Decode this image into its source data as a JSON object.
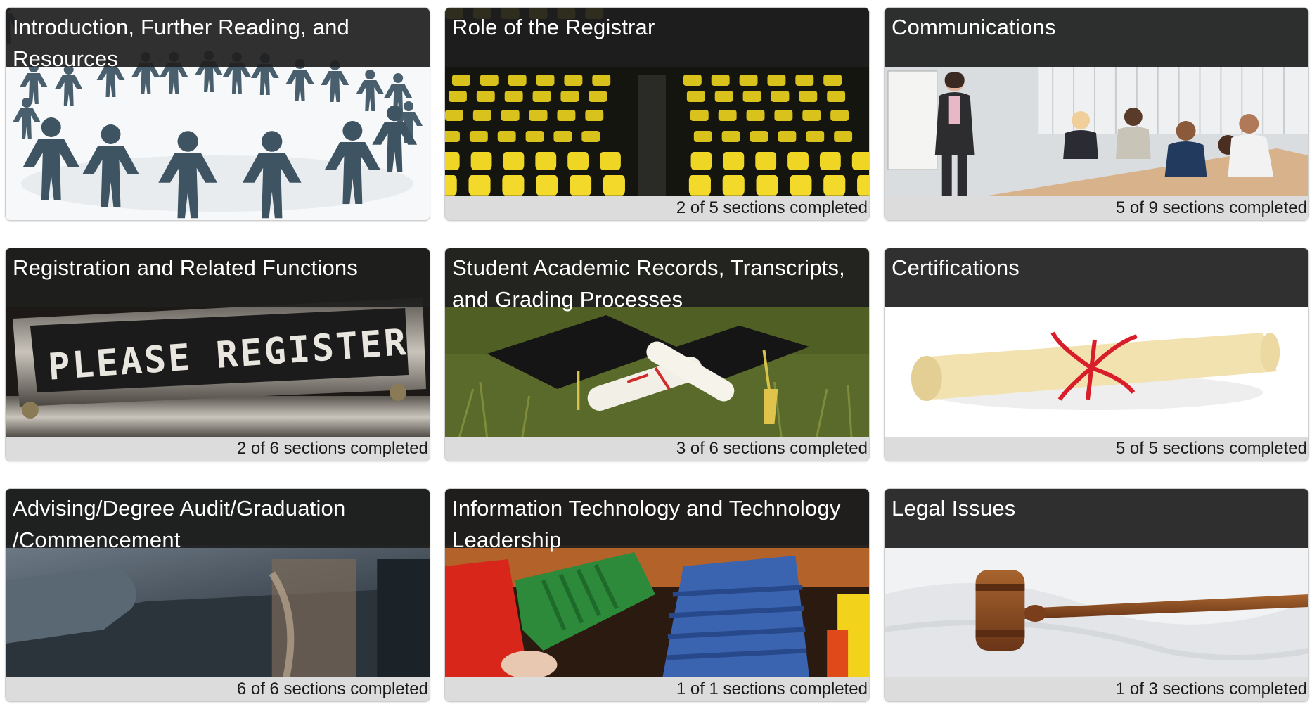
{
  "tiles": [
    {
      "title": "Introduction, Further Reading, and Resources",
      "progress": "",
      "image": "paper-people-circle-image"
    },
    {
      "title": "Role of the Registrar",
      "progress": "2 of 5 sections completed",
      "image": "auditorium-seats-image"
    },
    {
      "title": "Communications",
      "progress": "5 of 9 sections completed",
      "image": "meeting-room-image"
    },
    {
      "title": "Registration and Related Functions",
      "progress": "2 of 6 sections completed",
      "image": "please-register-sign-image",
      "sign_text": "PLEASE REGISTER"
    },
    {
      "title": "Student Academic Records, Transcripts, and Grading Processes",
      "progress": "3 of 6 sections completed",
      "image": "graduation-caps-diploma-image"
    },
    {
      "title": "Certifications",
      "progress": "5 of 5 sections completed",
      "image": "diploma-scroll-image"
    },
    {
      "title": "Advising/Degree Audit/Graduation /Commencement",
      "progress": "6 of 6 sections completed",
      "image": "graduation-cap-closeup-image"
    },
    {
      "title": "Information Technology and Technology Leadership",
      "progress": "1 of 1 sections completed",
      "image": "network-cables-image"
    },
    {
      "title": "Legal Issues",
      "progress": "1 of 3 sections completed",
      "image": "gavel-image"
    }
  ],
  "colors": {
    "title_bar": "#1e1e1e",
    "progress_bar": "#dcdcdc",
    "seat_yellow": "#e8d21e",
    "cable_red": "#d8261a",
    "cable_green": "#2c8a3a",
    "cable_blue": "#3a63b0",
    "gavel_brown": "#8a4a22"
  }
}
